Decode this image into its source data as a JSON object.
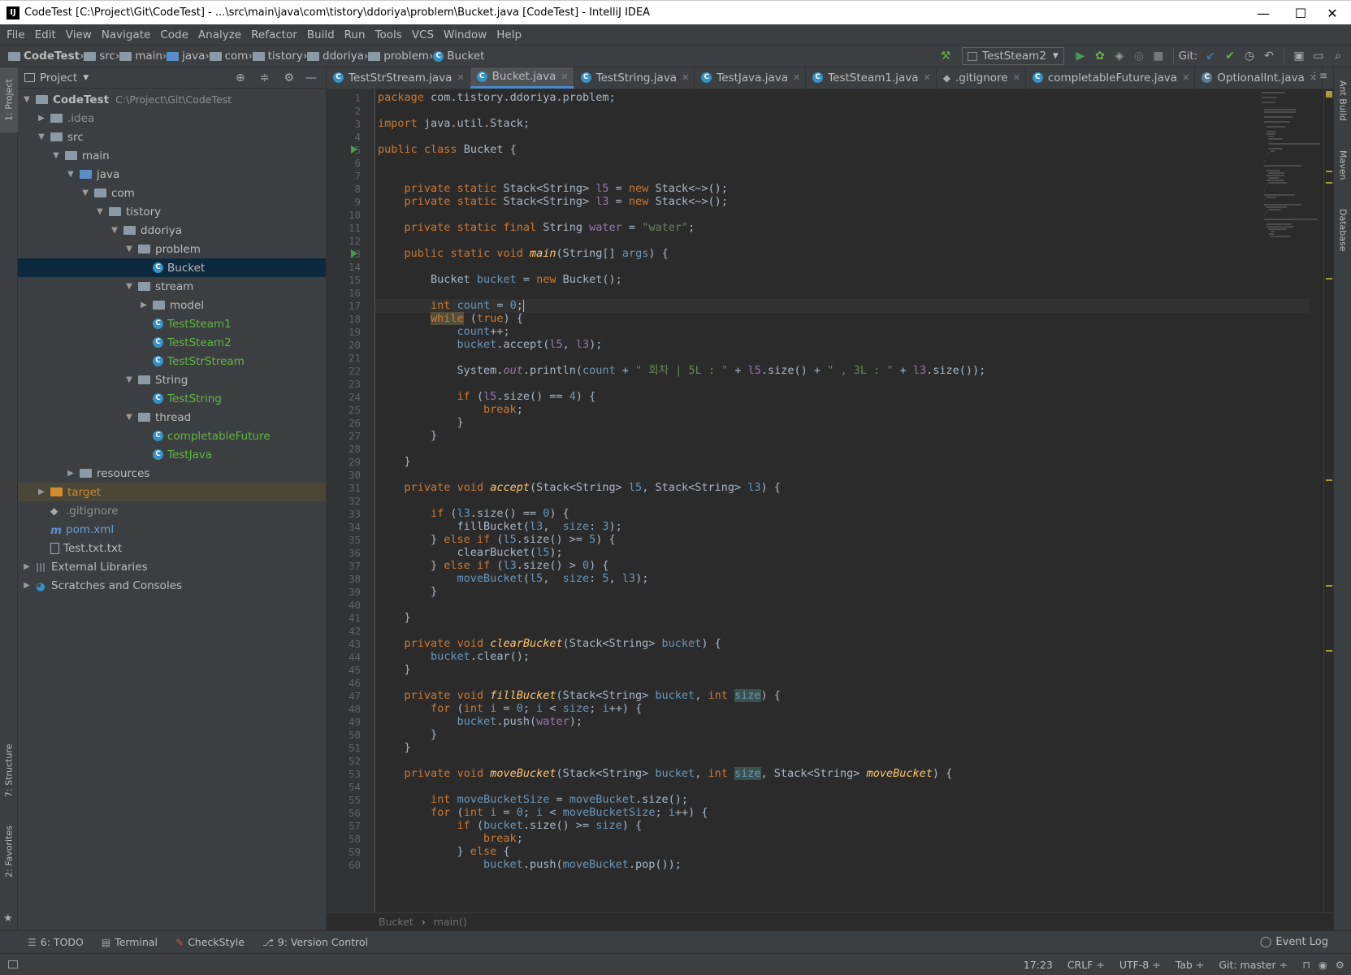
{
  "window": {
    "title": "CodeTest [C:\\Project\\Git\\CodeTest] - ...\\src\\main\\java\\com\\tistory\\ddoriya\\problem\\Bucket.java [CodeTest] - IntelliJ IDEA",
    "logo": "IJ",
    "minimize": "—",
    "maximize": "☐",
    "close": "✕"
  },
  "menu": [
    "File",
    "Edit",
    "View",
    "Navigate",
    "Code",
    "Analyze",
    "Refactor",
    "Build",
    "Run",
    "Tools",
    "VCS",
    "Window",
    "Help"
  ],
  "nav": {
    "crumbs": [
      "CodeTest",
      "src",
      "main",
      "java",
      "com",
      "tistory",
      "ddoriya",
      "problem",
      "Bucket"
    ],
    "run_config": "TestSteam2",
    "git_label": "Git:"
  },
  "project_panel": {
    "title": "Project",
    "tree": [
      {
        "label": "CodeTest",
        "extra": "C:\\Project\\Git\\CodeTest",
        "depth": 0,
        "arrow": "▼",
        "icon": "module-folder",
        "style": "bold"
      },
      {
        "label": ".idea",
        "depth": 1,
        "arrow": "▶",
        "icon": "folder",
        "style": "grey"
      },
      {
        "label": "src",
        "depth": 1,
        "arrow": "▼",
        "icon": "folder",
        "style": ""
      },
      {
        "label": "main",
        "depth": 2,
        "arrow": "▼",
        "icon": "folder",
        "style": ""
      },
      {
        "label": "java",
        "depth": 3,
        "arrow": "▼",
        "icon": "source-folder",
        "style": ""
      },
      {
        "label": "com",
        "depth": 4,
        "arrow": "▼",
        "icon": "package",
        "style": ""
      },
      {
        "label": "tistory",
        "depth": 5,
        "arrow": "▼",
        "icon": "package",
        "style": ""
      },
      {
        "label": "ddoriya",
        "depth": 6,
        "arrow": "▼",
        "icon": "package",
        "style": ""
      },
      {
        "label": "problem",
        "depth": 7,
        "arrow": "▼",
        "icon": "package",
        "style": ""
      },
      {
        "label": "Bucket",
        "depth": 8,
        "arrow": "",
        "icon": "class",
        "style": "selected"
      },
      {
        "label": "stream",
        "depth": 7,
        "arrow": "▼",
        "icon": "package",
        "style": ""
      },
      {
        "label": "model",
        "depth": 8,
        "arrow": "▶",
        "icon": "package",
        "style": ""
      },
      {
        "label": "TestSteam1",
        "depth": 8,
        "arrow": "",
        "icon": "class",
        "style": "green"
      },
      {
        "label": "TestSteam2",
        "depth": 8,
        "arrow": "",
        "icon": "class",
        "style": "green"
      },
      {
        "label": "TestStrStream",
        "depth": 8,
        "arrow": "",
        "icon": "class",
        "style": "green"
      },
      {
        "label": "String",
        "depth": 7,
        "arrow": "▼",
        "icon": "package",
        "style": ""
      },
      {
        "label": "TestString",
        "depth": 8,
        "arrow": "",
        "icon": "class",
        "style": "green"
      },
      {
        "label": "thread",
        "depth": 7,
        "arrow": "▼",
        "icon": "package",
        "style": ""
      },
      {
        "label": "completableFuture",
        "depth": 8,
        "arrow": "",
        "icon": "class",
        "style": "green"
      },
      {
        "label": "TestJava",
        "depth": 8,
        "arrow": "",
        "icon": "class",
        "style": "green"
      },
      {
        "label": "resources",
        "depth": 3,
        "arrow": "▶",
        "icon": "resource-folder",
        "style": ""
      },
      {
        "label": "target",
        "depth": 1,
        "arrow": "▶",
        "icon": "excluded-folder",
        "style": "excluded"
      },
      {
        "label": ".gitignore",
        "depth": 1,
        "arrow": "",
        "icon": "gitignore",
        "style": "grey"
      },
      {
        "label": "pom.xml",
        "depth": 1,
        "arrow": "",
        "icon": "maven",
        "style": "blue"
      },
      {
        "label": "Test.txt.txt",
        "depth": 1,
        "arrow": "",
        "icon": "text-file",
        "style": ""
      },
      {
        "label": "External Libraries",
        "depth": 0,
        "arrow": "▶",
        "icon": "libraries",
        "style": ""
      },
      {
        "label": "Scratches and Consoles",
        "depth": 0,
        "arrow": "▶",
        "icon": "scratches",
        "style": ""
      }
    ]
  },
  "left_tabs": [
    "1: Project",
    "7: Structure",
    "2: Favorites"
  ],
  "right_tabs": [
    "Ant Build",
    "Maven",
    "Database"
  ],
  "editor_tabs": [
    {
      "label": "TestStrStream.java",
      "active": false,
      "icon": "class"
    },
    {
      "label": "Bucket.java",
      "active": true,
      "icon": "class"
    },
    {
      "label": "TestString.java",
      "active": false,
      "icon": "class"
    },
    {
      "label": "TestJava.java",
      "active": false,
      "icon": "class"
    },
    {
      "label": "TestSteam1.java",
      "active": false,
      "icon": "class"
    },
    {
      "label": ".gitignore",
      "active": false,
      "icon": "gitignore"
    },
    {
      "label": "completableFuture.java",
      "active": false,
      "icon": "class"
    },
    {
      "label": "OptionalInt.java",
      "active": false,
      "icon": "class-lib"
    }
  ],
  "code": {
    "current_line": 17,
    "run_lines": [
      5,
      13
    ],
    "lines": [
      "package com.tistory.ddoriya.problem;",
      "",
      "import java.util.Stack;",
      "",
      "public class Bucket {",
      "",
      "",
      "    private static Stack<String> l5 = new Stack<~>();",
      "    private static Stack<String> l3 = new Stack<~>();",
      "",
      "    private static final String water = \"water\";",
      "",
      "    public static void main(String[] args) {",
      "",
      "        Bucket bucket = new Bucket();",
      "",
      "        int count = 0;",
      "        while (true) {",
      "            count++;",
      "            bucket.accept(l5, l3);",
      "",
      "            System.out.println(count + \" 회차 | 5L : \" + l5.size() + \" , 3L : \" + l3.size());",
      "",
      "            if (l5.size() == 4) {",
      "                break;",
      "            }",
      "        }",
      "",
      "    }",
      "",
      "    private void accept(Stack<String> l5, Stack<String> l3) {",
      "",
      "        if (l3.size() == 0) {",
      "            fillBucket(l3,  size: 3);",
      "        } else if (l5.size() >= 5) {",
      "            clearBucket(l5);",
      "        } else if (l3.size() > 0) {",
      "            moveBucket(l5,  size: 5, l3);",
      "        }",
      "",
      "    }",
      "",
      "    private void clearBucket(Stack<String> bucket) {",
      "        bucket.clear();",
      "    }",
      "",
      "    private void fillBucket(Stack<String> bucket, int size) {",
      "        for (int i = 0; i < size; i++) {",
      "            bucket.push(water);",
      "        }",
      "    }",
      "",
      "    private void moveBucket(Stack<String> bucket, int size, Stack<String> moveBucket) {",
      "",
      "        int moveBucketSize = moveBucket.size();",
      "        for (int i = 0; i < moveBucketSize; i++) {",
      "            if (bucket.size() >= size) {",
      "                break;",
      "            } else {",
      "                bucket.push(moveBucket.pop());"
    ]
  },
  "editor_breadcrumb": [
    "Bucket",
    "main()"
  ],
  "tool_windows": [
    {
      "label": "6: TODO",
      "icon": "todo-icon"
    },
    {
      "label": "Terminal",
      "icon": "terminal-icon"
    },
    {
      "label": "CheckStyle",
      "icon": "checkstyle-icon"
    },
    {
      "label": "9: Version Control",
      "icon": "vcs-icon"
    }
  ],
  "event_log": "Event Log",
  "status": {
    "position": "17:23",
    "line_sep": "CRLF ÷",
    "encoding": "UTF-8 ÷",
    "indent": "Tab ÷",
    "git_branch": "Git: master ÷"
  }
}
